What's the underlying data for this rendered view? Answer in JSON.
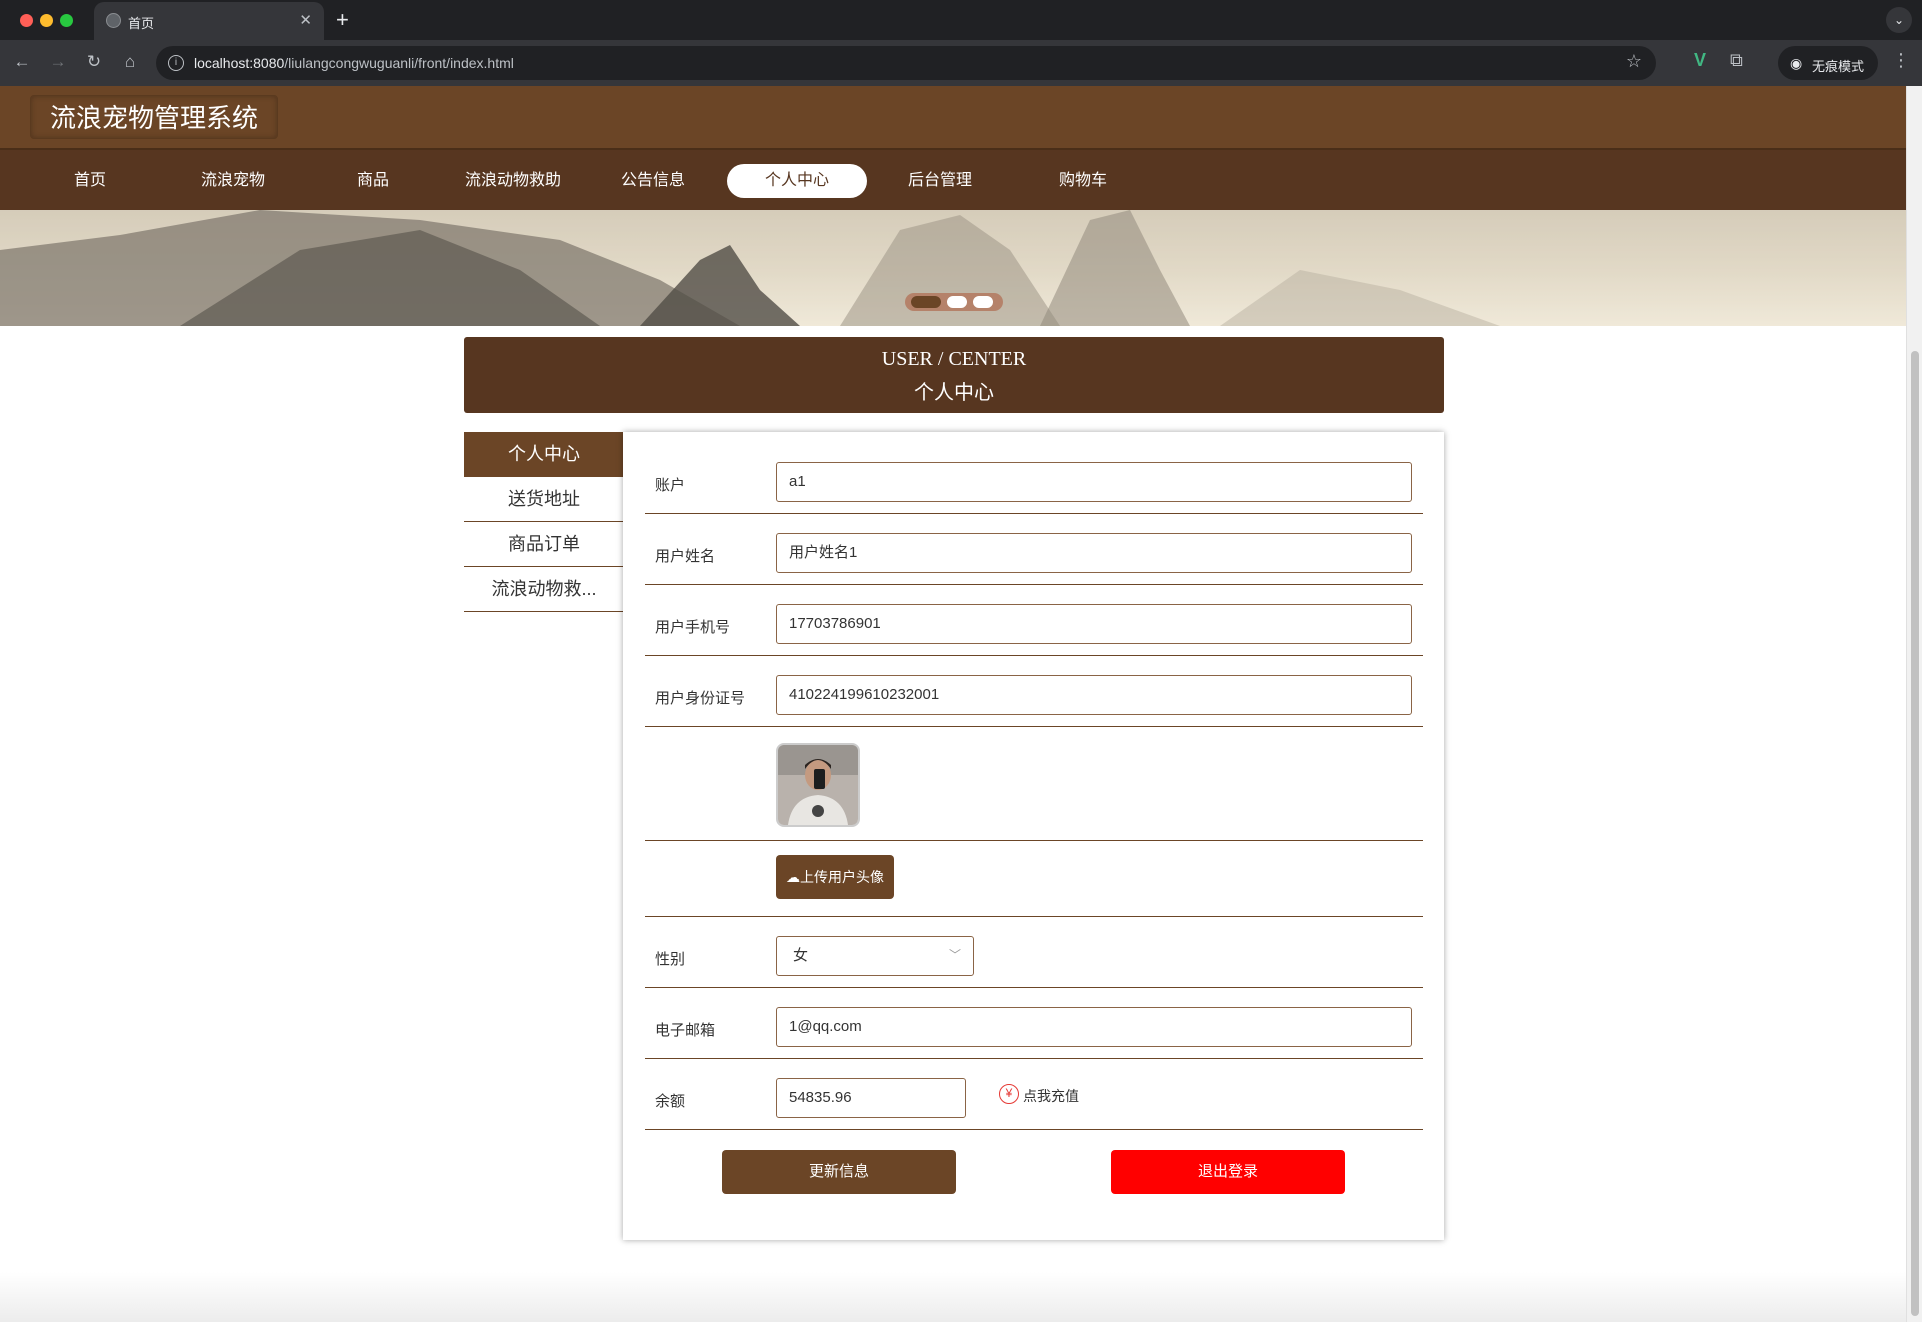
{
  "browser": {
    "tab_title": "首页",
    "url_host": "localhost:8080",
    "url_path": "/liulangcongwuguanli/front/index.html",
    "incognito_label": "无痕模式",
    "traffic_lights": [
      "#ff5f57",
      "#febc2e",
      "#28c840"
    ]
  },
  "site": {
    "logo": "流浪宠物管理系统",
    "nav": [
      "首页",
      "流浪宠物",
      "商品",
      "流浪动物救助",
      "公告信息",
      "个人中心",
      "后台管理",
      "购物车"
    ],
    "nav_active": "个人中心",
    "banner_slides": 3,
    "banner_active": 1
  },
  "center": {
    "title_en": "USER / CENTER",
    "title_cn": "个人中心"
  },
  "sidebar": {
    "items": [
      "个人中心",
      "送货地址",
      "商品订单",
      "流浪动物救..."
    ],
    "active": "个人中心"
  },
  "form": {
    "account_label": "账户",
    "account_value": "a1",
    "name_label": "用户姓名",
    "name_value": "用户姓名1",
    "phone_label": "用户手机号",
    "phone_value": "17703786901",
    "idcard_label": "用户身份证号",
    "idcard_value": "410224199610232001",
    "upload_label": "上传用户头像",
    "gender_label": "性别",
    "gender_value": "女",
    "email_label": "电子邮箱",
    "email_value": "1@qq.com",
    "balance_label": "余额",
    "balance_value": "54835.96",
    "recharge_label": "点我充值",
    "update_button": "更新信息",
    "logout_button": "退出登录"
  },
  "colors": {
    "brand_brown": "#6b4526",
    "nav_brown": "#573620",
    "logout_red": "#ff0000"
  }
}
